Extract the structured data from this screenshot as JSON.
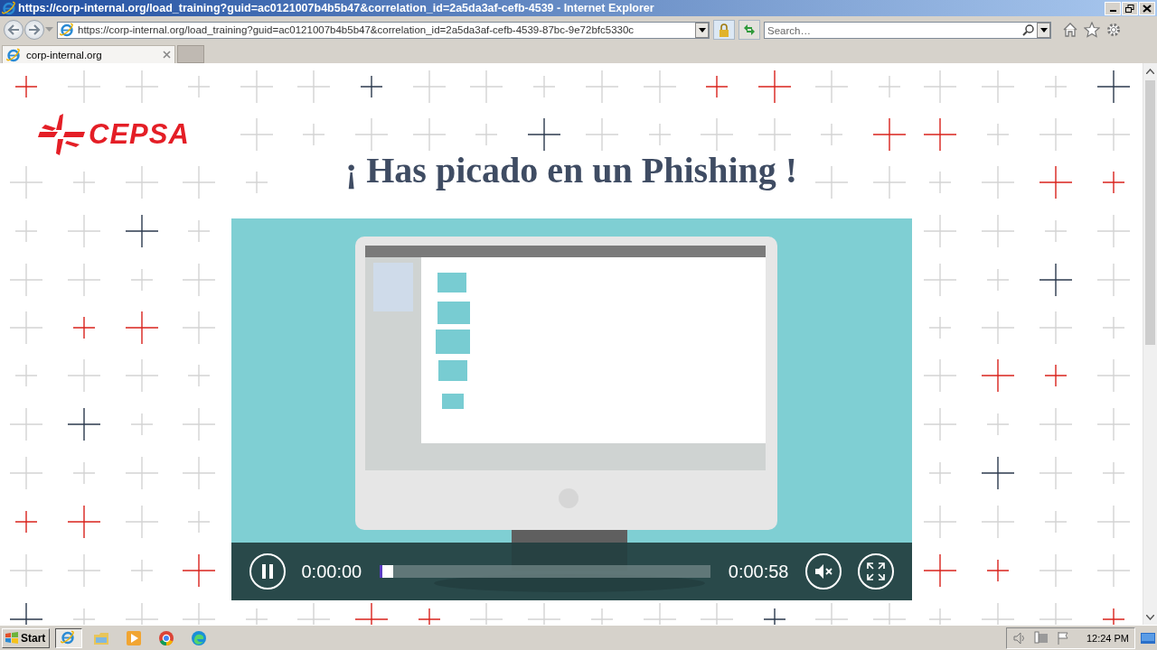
{
  "window": {
    "title": "https://corp-internal.org/load_training?guid=ac0121007b4b5b47&correlation_id=2a5da3af-cefb-4539 - Internet Explorer"
  },
  "address_bar": {
    "url": "https://corp-internal.org/load_training?guid=ac0121007b4b5b47&correlation_id=2a5da3af-cefb-4539-87bc-9e72bfc5330c"
  },
  "search": {
    "placeholder": "Search…"
  },
  "tabs": [
    {
      "label": "corp-internal.org",
      "selected": true
    }
  ],
  "page": {
    "logo": "CEPSA",
    "heading": "¡ Has picado en un Phishing !"
  },
  "video": {
    "playing": true,
    "current_time": "0:00:00",
    "duration": "0:00:58",
    "level": 0.04,
    "muted": true
  },
  "taskbar": {
    "start": "Start",
    "clock": "12:24 PM"
  }
}
